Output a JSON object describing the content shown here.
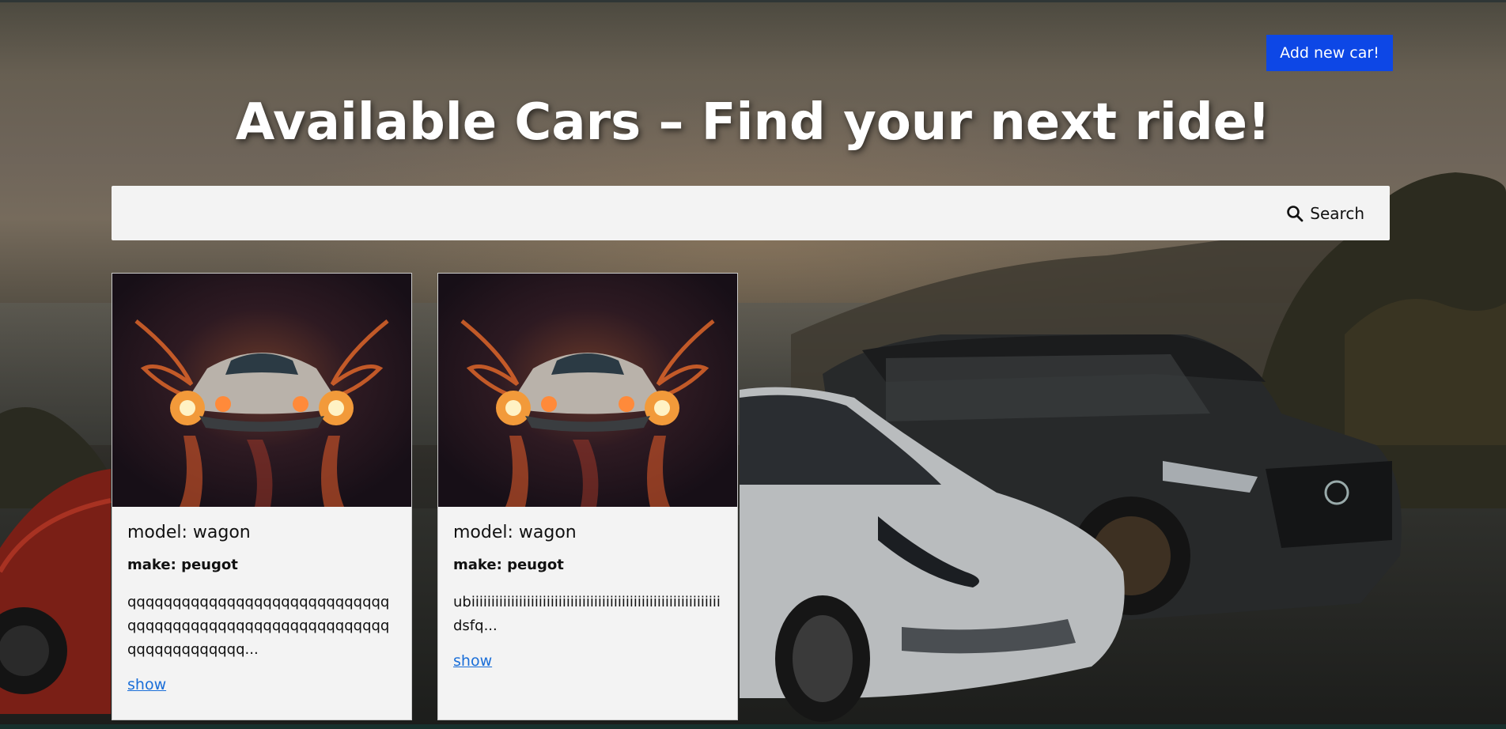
{
  "header": {
    "add_button_label": "Add new car!",
    "title": "Available Cars – Find your next ride!"
  },
  "search": {
    "placeholder": "",
    "value": "",
    "button_label": "Search",
    "icon": "search-icon"
  },
  "cars": [
    {
      "model": "model: wagon",
      "make": "make: peugot",
      "description": "qqqqqqqqqqqqqqqqqqqqqqqqqqqqqqqqqqqqqqqqqqqqqqqqqqqqqqqqqqqqqqqqqqqqqqq...",
      "link": "show"
    },
    {
      "model": "model: wagon",
      "make": "make: peugot",
      "description": "ubiiiiiiiiiiiiiiiiiiiiiiiiiiiiiiiiiiiiiiiiiiiiiiiiiiiiiiiiiiiiiiidsfq...",
      "link": "show"
    }
  ],
  "colors": {
    "accent": "#0d47e6",
    "link": "#1a6ed8",
    "card_bg": "#f3f3f3"
  }
}
